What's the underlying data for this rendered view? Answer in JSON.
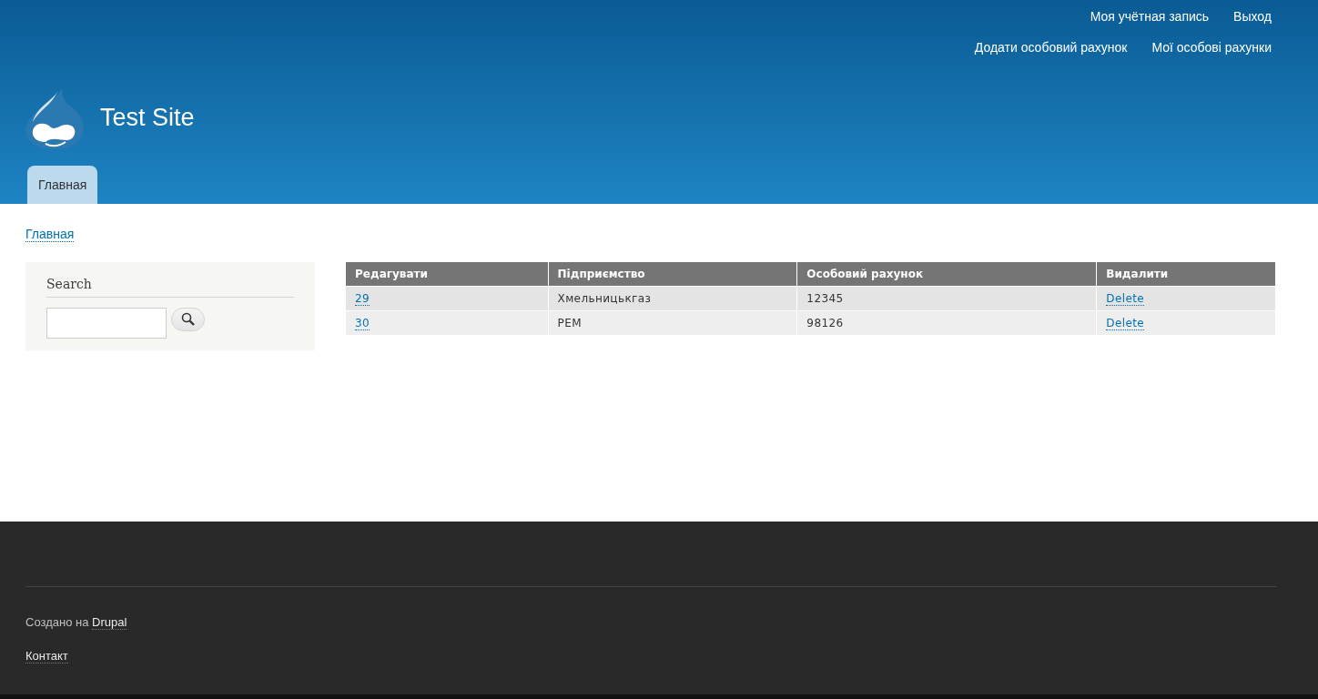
{
  "header": {
    "secondary_menu": [
      "Моя учётная запись",
      "Выход"
    ],
    "user_menu": [
      "Додати особовий рахунок",
      "Мої особові рахунки"
    ],
    "site_name": "Test Site",
    "main_tabs": [
      {
        "label": "Главная",
        "selected": true
      }
    ]
  },
  "breadcrumb": "Главная",
  "sidebar": {
    "title": "Search"
  },
  "table": {
    "columns": [
      "Редагувати",
      "Підприємство",
      "Особовий рахунок",
      "Видалити"
    ],
    "rows": [
      {
        "id": "29",
        "company": "Хмельницькгаз",
        "account": "12345",
        "action": "Delete"
      },
      {
        "id": "30",
        "company": "РЕМ",
        "account": "98126",
        "action": "Delete"
      }
    ]
  },
  "footer": {
    "credit_prefix": "Создано на",
    "credit_link": "Drupal",
    "links": [
      "Контакт"
    ]
  }
}
